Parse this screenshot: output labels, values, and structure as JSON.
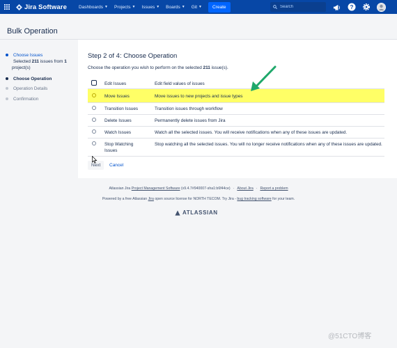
{
  "topnav": {
    "logo_text": "Jira Software",
    "items": [
      {
        "label": "Dashboards"
      },
      {
        "label": "Projects"
      },
      {
        "label": "Issues"
      },
      {
        "label": "Boards"
      },
      {
        "label": "Git"
      }
    ],
    "create_label": "Create",
    "search_placeholder": "Search"
  },
  "page": {
    "title": "Bulk Operation"
  },
  "sidebar": {
    "steps": [
      {
        "label": "Choose Issues",
        "state": "done",
        "detail_prefix": "Selected ",
        "detail_count": "211",
        "detail_mid": " issues from ",
        "detail_projects": "1",
        "detail_suffix": " project(s)"
      },
      {
        "label": "Choose Operation",
        "state": "current"
      },
      {
        "label": "Operation Details",
        "state": "todo"
      },
      {
        "label": "Confirmation",
        "state": "todo"
      }
    ]
  },
  "main": {
    "step_title": "Step 2 of 4: Choose Operation",
    "desc_prefix": "Choose the operation you wish to perform on the selected ",
    "desc_count": "211",
    "desc_suffix": " issue(s).",
    "operations": [
      {
        "name": "Edit Issues",
        "description": "Edit field values of issues"
      },
      {
        "name": "Move Issues",
        "description": "Move issues to new projects and issue types"
      },
      {
        "name": "Transition Issues",
        "description": "Transition issues through workflow"
      },
      {
        "name": "Delete Issues",
        "description": "Permanently delete issues from Jira"
      },
      {
        "name": "Watch Issues",
        "description": "Watch all the selected issues. You will receive notifications when any of these issues are updated."
      },
      {
        "name": "Stop Watching Issues",
        "description": "Stop watching all the selected issues. You will no longer receive notifications when any of these issues are updated."
      }
    ],
    "next_label": "Next",
    "cancel_label": "Cancel"
  },
  "footer": {
    "line1_prefix": "Atlassian Jira ",
    "line1_link": "Project Management Software",
    "line1_version": " (v9.4.7#940007-sha1:b6f44ce)",
    "line1_about": "About Jira",
    "line1_report": "Report a problem",
    "line2_prefix": "Powered by a free Atlassian ",
    "line2_jira": "Jira",
    "line2_mid": " open source license for NORTH TECOM. Try Jira - ",
    "line2_bug": "bug tracking software",
    "line2_suffix": " for your team.",
    "logo_text": "ATLASSIAN"
  },
  "watermark": "@51CTO博客",
  "colors": {
    "nav_bg": "#0747a6",
    "create_bg": "#0065ff",
    "highlight": "#ffff66",
    "arrow": "#1fa86b",
    "link": "#0052cc"
  }
}
